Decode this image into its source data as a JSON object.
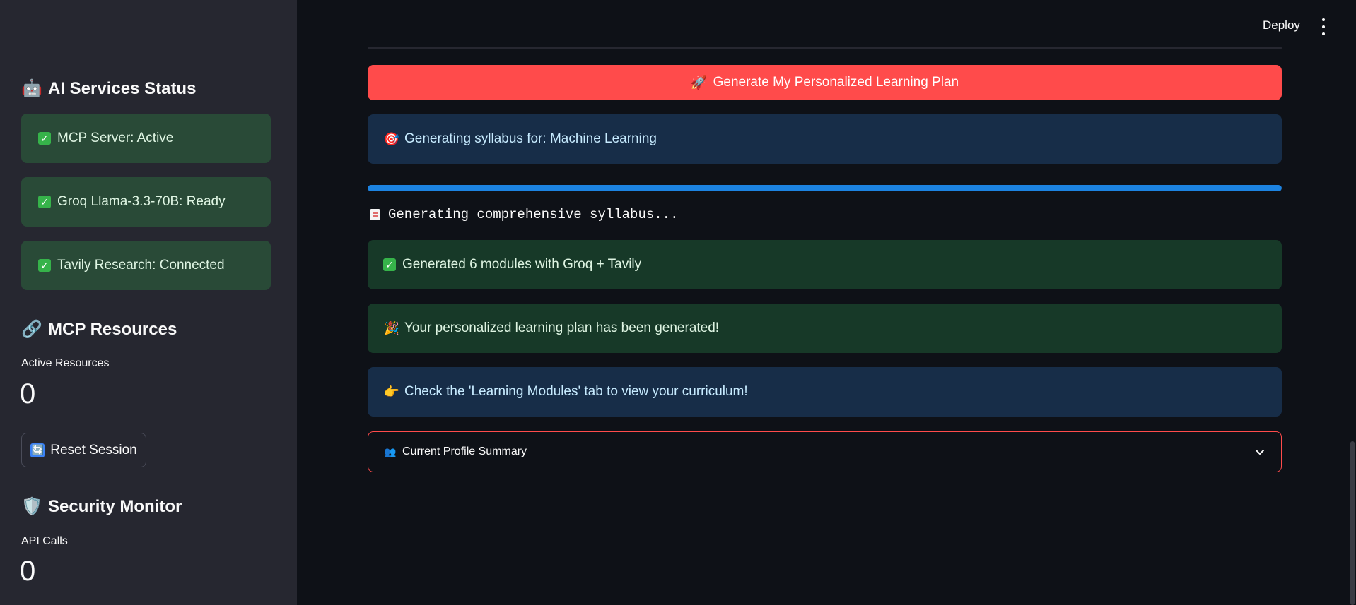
{
  "header": {
    "deploy_label": "Deploy"
  },
  "sidebar": {
    "ai_status": {
      "title": "AI Services Status",
      "items": [
        {
          "label": "MCP Server: Active"
        },
        {
          "label": "Groq Llama-3.3-70B: Ready"
        },
        {
          "label": "Tavily Research: Connected"
        }
      ]
    },
    "mcp_resources": {
      "title": "MCP Resources",
      "metric_label": "Active Resources",
      "metric_value": "0"
    },
    "reset_label": "Reset Session",
    "security": {
      "title": "Security Monitor",
      "metric_label": "API Calls",
      "metric_value": "0"
    }
  },
  "main": {
    "generate_button": "Generate My Personalized Learning Plan",
    "info_generating": "Generating syllabus for: Machine Learning",
    "progress": 1.0,
    "code_text": "Generating comprehensive syllabus...",
    "success_modules": "Generated 6 modules with Groq + Tavily",
    "success_plan": "Your personalized learning plan has been generated!",
    "info_check": "Check the 'Learning Modules' tab to view your curriculum!",
    "expander_label": "Current Profile Summary"
  },
  "colors": {
    "primary": "#ff4b4b",
    "info_bg": "#172d48",
    "success_bg": "#173928",
    "progress": "#1c83e1",
    "sidebar_bg": "#262730",
    "app_bg": "#0e1117"
  }
}
